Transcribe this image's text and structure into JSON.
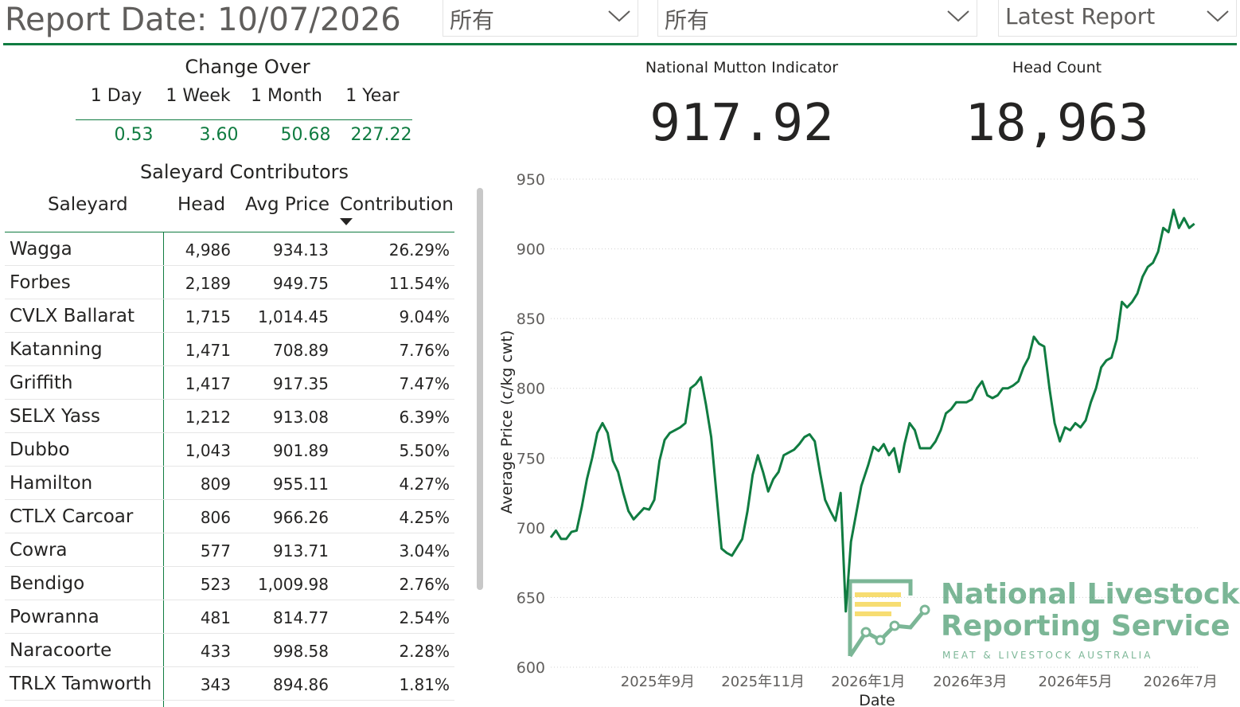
{
  "header": {
    "report_date": "Report Date: 10/07/2026",
    "slicers": [
      {
        "value": "所有"
      },
      {
        "value": "所有"
      },
      {
        "value": "Latest Report"
      }
    ]
  },
  "change_over": {
    "title": "Change Over",
    "columns": [
      "1 Day",
      "1 Week",
      "1 Month",
      "1 Year"
    ],
    "values": [
      "0.53",
      "3.60",
      "50.68",
      "227.22"
    ]
  },
  "saleyard_contributors": {
    "title": "Saleyard Contributors",
    "headers": {
      "saleyard": "Saleyard",
      "head": "Head",
      "avg_price": "Avg Price",
      "contribution": "Contribution"
    },
    "rows": [
      {
        "saleyard": "Wagga",
        "head": "4,986",
        "avg_price": "934.13",
        "contribution": "26.29%"
      },
      {
        "saleyard": "Forbes",
        "head": "2,189",
        "avg_price": "949.75",
        "contribution": "11.54%"
      },
      {
        "saleyard": "CVLX Ballarat",
        "head": "1,715",
        "avg_price": "1,014.45",
        "contribution": "9.04%"
      },
      {
        "saleyard": "Katanning",
        "head": "1,471",
        "avg_price": "708.89",
        "contribution": "7.76%"
      },
      {
        "saleyard": "Griffith",
        "head": "1,417",
        "avg_price": "917.35",
        "contribution": "7.47%"
      },
      {
        "saleyard": "SELX Yass",
        "head": "1,212",
        "avg_price": "913.08",
        "contribution": "6.39%"
      },
      {
        "saleyard": "Dubbo",
        "head": "1,043",
        "avg_price": "901.89",
        "contribution": "5.50%"
      },
      {
        "saleyard": "Hamilton",
        "head": "809",
        "avg_price": "955.11",
        "contribution": "4.27%"
      },
      {
        "saleyard": "CTLX Carcoar",
        "head": "806",
        "avg_price": "966.26",
        "contribution": "4.25%"
      },
      {
        "saleyard": "Cowra",
        "head": "577",
        "avg_price": "913.71",
        "contribution": "3.04%"
      },
      {
        "saleyard": "Bendigo",
        "head": "523",
        "avg_price": "1,009.98",
        "contribution": "2.76%"
      },
      {
        "saleyard": "Powranna",
        "head": "481",
        "avg_price": "814.77",
        "contribution": "2.54%"
      },
      {
        "saleyard": "Naracoorte",
        "head": "433",
        "avg_price": "998.58",
        "contribution": "2.28%"
      },
      {
        "saleyard": "TRLX Tamworth",
        "head": "343",
        "avg_price": "894.86",
        "contribution": "1.81%"
      }
    ]
  },
  "kpis": {
    "indicator_label": "National Mutton Indicator",
    "indicator_value": "917.92",
    "headcount_label": "Head Count",
    "headcount_value": "18,963"
  },
  "logo": {
    "line1": "National Livestock",
    "line2": "Reporting Service",
    "line3": "MEAT & LIVESTOCK AUSTRALIA"
  },
  "colors": {
    "accent": "#107c41",
    "text": "#252423",
    "muted": "#605e5c"
  },
  "chart_data": {
    "type": "line",
    "xlabel": "Date",
    "ylabel": "Average Price (c/kg cwt)",
    "ylim": [
      600,
      950
    ],
    "yticks": [
      600,
      650,
      700,
      750,
      800,
      850,
      900,
      950
    ],
    "xlim": [
      "2025-07-01",
      "2026-07-11"
    ],
    "xticks": [
      {
        "date": "2025-09-01",
        "label": "2025年9月"
      },
      {
        "date": "2025-11-01",
        "label": "2025年11月"
      },
      {
        "date": "2026-01-01",
        "label": "2026年1月"
      },
      {
        "date": "2026-03-01",
        "label": "2026年3月"
      },
      {
        "date": "2026-05-01",
        "label": "2026年5月"
      },
      {
        "date": "2026-07-01",
        "label": "2026年7月"
      }
    ],
    "grid": true,
    "series": [
      {
        "color": "#107c41",
        "points": [
          [
            "2025-07-01",
            693
          ],
          [
            "2025-07-04",
            698
          ],
          [
            "2025-07-07",
            692
          ],
          [
            "2025-07-10",
            692
          ],
          [
            "2025-07-13",
            697
          ],
          [
            "2025-07-16",
            698
          ],
          [
            "2025-07-19",
            715
          ],
          [
            "2025-07-22",
            735
          ],
          [
            "2025-07-25",
            750
          ],
          [
            "2025-07-28",
            768
          ],
          [
            "2025-07-31",
            775
          ],
          [
            "2025-08-03",
            768
          ],
          [
            "2025-08-06",
            748
          ],
          [
            "2025-08-09",
            740
          ],
          [
            "2025-08-12",
            725
          ],
          [
            "2025-08-15",
            712
          ],
          [
            "2025-08-18",
            706
          ],
          [
            "2025-08-21",
            710
          ],
          [
            "2025-08-24",
            714
          ],
          [
            "2025-08-27",
            713
          ],
          [
            "2025-08-30",
            720
          ],
          [
            "2025-09-02",
            748
          ],
          [
            "2025-09-05",
            763
          ],
          [
            "2025-09-08",
            768
          ],
          [
            "2025-09-11",
            770
          ],
          [
            "2025-09-14",
            772
          ],
          [
            "2025-09-17",
            775
          ],
          [
            "2025-09-20",
            800
          ],
          [
            "2025-09-23",
            803
          ],
          [
            "2025-09-26",
            808
          ],
          [
            "2025-09-29",
            788
          ],
          [
            "2025-10-02",
            765
          ],
          [
            "2025-10-05",
            725
          ],
          [
            "2025-10-08",
            685
          ],
          [
            "2025-10-11",
            682
          ],
          [
            "2025-10-14",
            680
          ],
          [
            "2025-10-17",
            686
          ],
          [
            "2025-10-20",
            692
          ],
          [
            "2025-10-23",
            712
          ],
          [
            "2025-10-26",
            738
          ],
          [
            "2025-10-29",
            752
          ],
          [
            "2025-11-01",
            740
          ],
          [
            "2025-11-04",
            726
          ],
          [
            "2025-11-07",
            735
          ],
          [
            "2025-11-10",
            740
          ],
          [
            "2025-11-13",
            752
          ],
          [
            "2025-11-16",
            754
          ],
          [
            "2025-11-19",
            756
          ],
          [
            "2025-11-22",
            760
          ],
          [
            "2025-11-25",
            765
          ],
          [
            "2025-11-28",
            767
          ],
          [
            "2025-12-01",
            762
          ],
          [
            "2025-12-04",
            740
          ],
          [
            "2025-12-07",
            720
          ],
          [
            "2025-12-10",
            712
          ],
          [
            "2025-12-13",
            705
          ],
          [
            "2025-12-16",
            725
          ],
          [
            "2025-12-19",
            640
          ],
          [
            "2025-12-22",
            690
          ],
          [
            "2025-12-25",
            710
          ],
          [
            "2025-12-28",
            730
          ],
          [
            "2026-01-01",
            745
          ],
          [
            "2026-01-04",
            758
          ],
          [
            "2026-01-07",
            755
          ],
          [
            "2026-01-10",
            760
          ],
          [
            "2026-01-13",
            752
          ],
          [
            "2026-01-16",
            757
          ],
          [
            "2026-01-19",
            740
          ],
          [
            "2026-01-22",
            760
          ],
          [
            "2026-01-25",
            775
          ],
          [
            "2026-01-28",
            770
          ],
          [
            "2026-01-31",
            757
          ],
          [
            "2026-02-03",
            757
          ],
          [
            "2026-02-06",
            757
          ],
          [
            "2026-02-09",
            762
          ],
          [
            "2026-02-12",
            770
          ],
          [
            "2026-02-15",
            782
          ],
          [
            "2026-02-18",
            785
          ],
          [
            "2026-02-21",
            790
          ],
          [
            "2026-02-24",
            790
          ],
          [
            "2026-02-27",
            790
          ],
          [
            "2026-03-02",
            792
          ],
          [
            "2026-03-05",
            800
          ],
          [
            "2026-03-08",
            805
          ],
          [
            "2026-03-11",
            795
          ],
          [
            "2026-03-14",
            793
          ],
          [
            "2026-03-17",
            795
          ],
          [
            "2026-03-20",
            800
          ],
          [
            "2026-03-23",
            800
          ],
          [
            "2026-03-26",
            802
          ],
          [
            "2026-03-29",
            805
          ],
          [
            "2026-04-01",
            815
          ],
          [
            "2026-04-04",
            822
          ],
          [
            "2026-04-07",
            837
          ],
          [
            "2026-04-10",
            832
          ],
          [
            "2026-04-13",
            830
          ],
          [
            "2026-04-16",
            800
          ],
          [
            "2026-04-19",
            775
          ],
          [
            "2026-04-22",
            762
          ],
          [
            "2026-04-25",
            772
          ],
          [
            "2026-04-28",
            770
          ],
          [
            "2026-05-01",
            775
          ],
          [
            "2026-05-04",
            772
          ],
          [
            "2026-05-07",
            777
          ],
          [
            "2026-05-10",
            790
          ],
          [
            "2026-05-13",
            800
          ],
          [
            "2026-05-16",
            815
          ],
          [
            "2026-05-19",
            820
          ],
          [
            "2026-05-22",
            822
          ],
          [
            "2026-05-25",
            835
          ],
          [
            "2026-05-28",
            862
          ],
          [
            "2026-05-31",
            858
          ],
          [
            "2026-06-03",
            862
          ],
          [
            "2026-06-06",
            868
          ],
          [
            "2026-06-09",
            880
          ],
          [
            "2026-06-12",
            887
          ],
          [
            "2026-06-15",
            890
          ],
          [
            "2026-06-18",
            898
          ],
          [
            "2026-06-21",
            915
          ],
          [
            "2026-06-24",
            912
          ],
          [
            "2026-06-27",
            928
          ],
          [
            "2026-06-30",
            915
          ],
          [
            "2026-07-03",
            922
          ],
          [
            "2026-07-06",
            915
          ],
          [
            "2026-07-09",
            918
          ]
        ]
      }
    ]
  }
}
